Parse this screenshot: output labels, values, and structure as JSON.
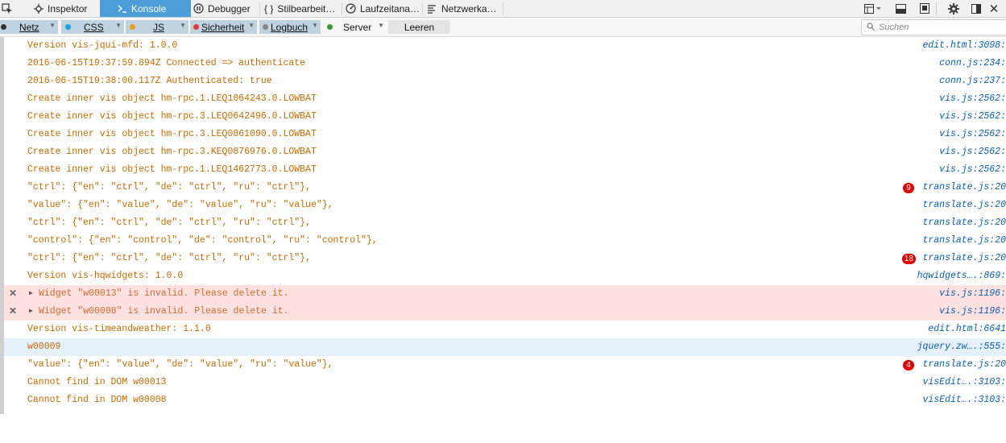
{
  "tabs": [
    {
      "label": "Inspektor",
      "icon": "inspector-icon"
    },
    {
      "label": "Konsole",
      "icon": "console-icon"
    },
    {
      "label": "Debugger",
      "icon": "debugger-icon"
    },
    {
      "label": "Stilbearbeit…",
      "icon": "style-editor-icon"
    },
    {
      "label": "Laufzeitana…",
      "icon": "performance-icon"
    },
    {
      "label": "Netzwerka…",
      "icon": "network-icon"
    }
  ],
  "filters": [
    {
      "label": "Netz",
      "color": "#333333"
    },
    {
      "label": "CSS",
      "color": "#1aa1e0"
    },
    {
      "label": "JS",
      "color": "#f19b1a"
    },
    {
      "label": "Sicherheit",
      "color": "#e23a3a"
    },
    {
      "label": "Logbuch",
      "color": "#888888"
    },
    {
      "label": "Server",
      "color": "#3a9a3a"
    }
  ],
  "clear_label": "Leeren",
  "search_placeholder": "Suchen",
  "messages": [
    {
      "text": "Version vis-jqui-mfd: 1.0.0",
      "loc": "edit.html:3098:"
    },
    {
      "text": "2016-06-15T19:37:59.894Z Connected => authenticate",
      "loc": "conn.js:234:"
    },
    {
      "text": "2016-06-15T19:38:00.117Z Authenticated: true",
      "loc": "conn.js:237:"
    },
    {
      "text": "Create inner vis object hm-rpc.1.LEQ1064243.0.LOWBAT",
      "loc": "vis.js:2562:"
    },
    {
      "text": "Create inner vis object hm-rpc.3.LEQ0642496.0.LOWBAT",
      "loc": "vis.js:2562:"
    },
    {
      "text": "Create inner vis object hm-rpc.3.LEQ0861090.0.LOWBAT",
      "loc": "vis.js:2562:"
    },
    {
      "text": "Create inner vis object hm-rpc.3.KEQ0876976.0.LOWBAT",
      "loc": "vis.js:2562:"
    },
    {
      "text": "Create inner vis object hm-rpc.1.LEQ1462773.0.LOWBAT",
      "loc": "vis.js:2562:"
    },
    {
      "text": "\"ctrl\": {\"en\": \"ctrl\", \"de\": \"ctrl\", \"ru\": \"ctrl\"},",
      "loc": "translate.js:20",
      "count": "9"
    },
    {
      "text": "\"value\": {\"en\": \"value\", \"de\": \"value\", \"ru\": \"value\"},",
      "loc": "translate.js:20"
    },
    {
      "text": "\"ctrl\": {\"en\": \"ctrl\", \"de\": \"ctrl\", \"ru\": \"ctrl\"},",
      "loc": "translate.js:20"
    },
    {
      "text": "\"control\": {\"en\": \"control\", \"de\": \"control\", \"ru\": \"control\"},",
      "loc": "translate.js:20"
    },
    {
      "text": "\"ctrl\": {\"en\": \"ctrl\", \"de\": \"ctrl\", \"ru\": \"ctrl\"},",
      "loc": "translate.js:20",
      "count": "18"
    },
    {
      "text": "Version vis-hqwidgets: 1.0.0",
      "loc": "hqwidgets….:869:"
    },
    {
      "text": "Widget \"w00013\" is invalid. Please delete it.",
      "loc": "vis.js:1196:",
      "kind": "error"
    },
    {
      "text": "Widget \"w00008\" is invalid. Please delete it.",
      "loc": "vis.js:1196:",
      "kind": "error"
    },
    {
      "text": "Version vis-timeandweather: 1.1.0",
      "loc": "edit.html:6641"
    },
    {
      "text": "w00009",
      "loc": "jquery.zw….:555:",
      "kind": "highlight"
    },
    {
      "text": "\"value\": {\"en\": \"value\", \"de\": \"value\", \"ru\": \"value\"},",
      "loc": "translate.js:20",
      "count": "4"
    },
    {
      "text": "Cannot find in DOM w00013",
      "loc": "visEdit….:3103:"
    },
    {
      "text": "Cannot find in DOM w00008",
      "loc": "visEdit….:3103:"
    }
  ]
}
